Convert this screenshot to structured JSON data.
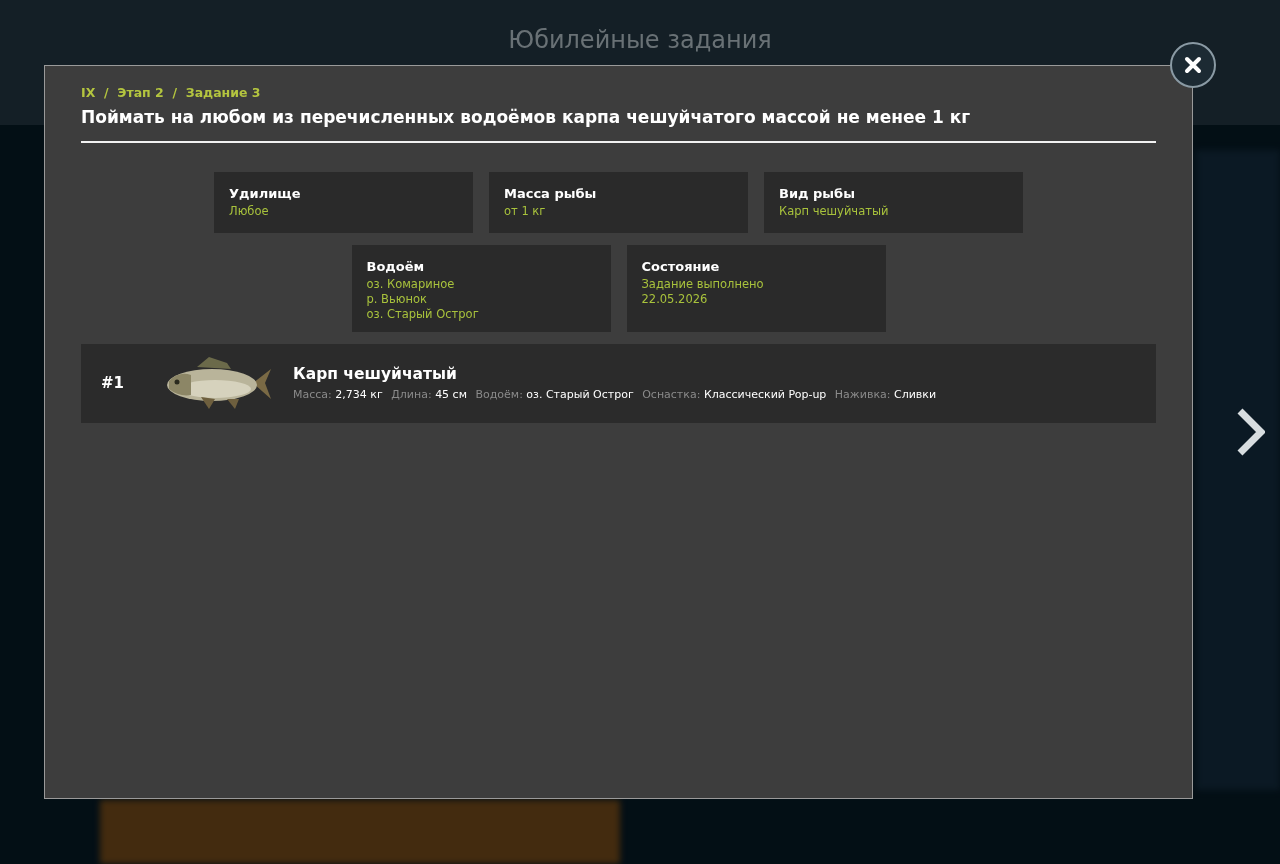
{
  "page": {
    "title": "Юбилейные задания"
  },
  "dialog": {
    "breadcrumb": "IX  /  Этап 2  /  Задание 3",
    "title": "Поймать на любом из перечисленных водоёмов карпа чешуйчатого массой не менее 1 кг",
    "conditions": [
      {
        "label": "Удилище",
        "values": [
          "Любое"
        ]
      },
      {
        "label": "Масса рыбы",
        "values": [
          "от 1 кг"
        ]
      },
      {
        "label": "Вид рыбы",
        "values": [
          "Карп чешуйчатый"
        ]
      },
      {
        "label": "Водоём",
        "values": [
          "оз. Комариное",
          "р. Вьюнок",
          "оз. Старый Острог"
        ]
      },
      {
        "label": "Состояние",
        "values": [
          "Задание выполнено",
          "22.05.2026"
        ]
      }
    ],
    "catches": [
      {
        "rank": "#1",
        "name": "Карп чешуйчатый",
        "details": [
          {
            "label": "Масса:",
            "value": "2,734 кг"
          },
          {
            "label": "Длина:",
            "value": "45 см"
          },
          {
            "label": "Водоём:",
            "value": "оз. Старый Острог"
          },
          {
            "label": "Оснастка:",
            "value": "Классический Pop-up"
          },
          {
            "label": "Наживка:",
            "value": "Сливки"
          }
        ]
      }
    ]
  }
}
